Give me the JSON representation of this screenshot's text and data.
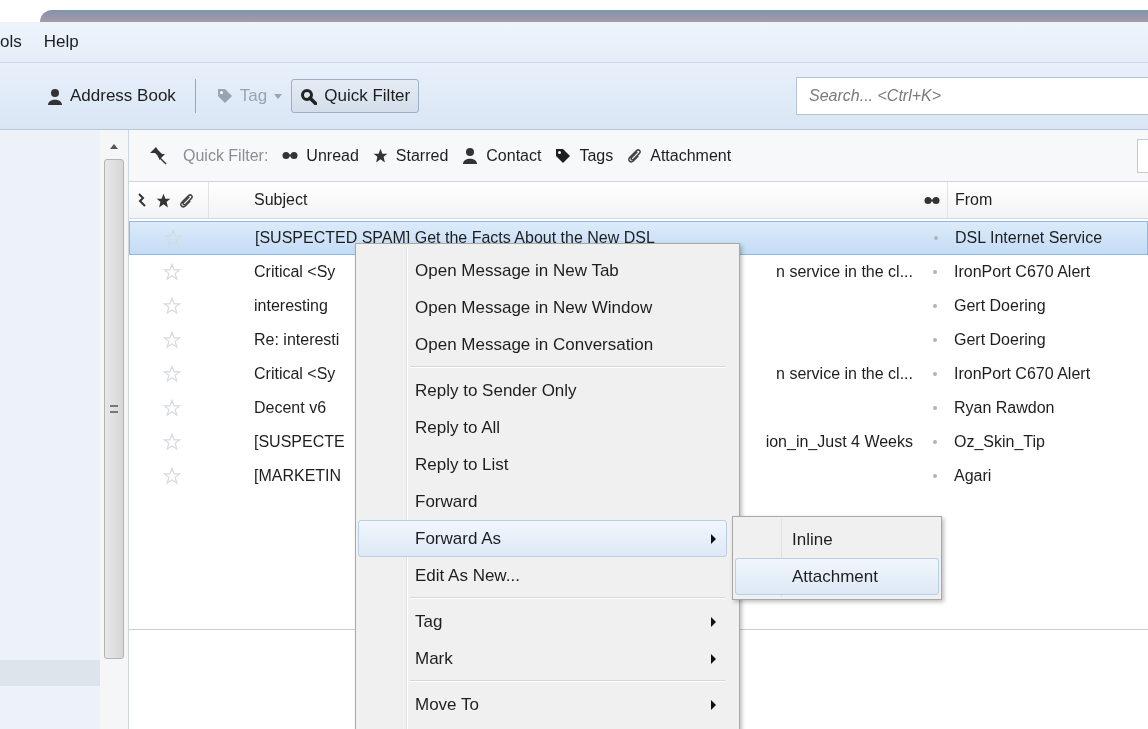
{
  "menubar": [
    {
      "label": "ols"
    },
    {
      "label": "Help"
    }
  ],
  "toolbar": {
    "buttons": [
      {
        "label": "Address Book",
        "kind": "contact",
        "disabled": false,
        "pressed": false,
        "dropdown": false
      },
      {
        "label": "Tag",
        "kind": "tag",
        "disabled": true,
        "pressed": false,
        "dropdown": true
      },
      {
        "label": "Quick Filter",
        "kind": "search",
        "disabled": false,
        "pressed": true,
        "dropdown": false
      }
    ],
    "search": {
      "placeholder": "Search... <Ctrl+K>"
    }
  },
  "quick_filter": {
    "label": "Quick Filter:",
    "filters": [
      {
        "label": "Unread",
        "kind": "unread"
      },
      {
        "label": "Starred",
        "kind": "starred"
      },
      {
        "label": "Contact",
        "kind": "contact"
      },
      {
        "label": "Tags",
        "kind": "tag"
      },
      {
        "label": "Attachment",
        "kind": "attachment"
      }
    ]
  },
  "columns": {
    "subject": "Subject",
    "from": "From"
  },
  "messages": [
    {
      "subject_start": "[SUSPECTED SPAM] Get the Facts About the New DSL",
      "from": "DSL Internet Service",
      "selected": true,
      "starred": false
    },
    {
      "subject_start": "Critical <Sy",
      "subject_end": "n service in the cl...",
      "from": "IronPort C670 Alert",
      "selected": false,
      "starred": false
    },
    {
      "subject_start": "interesting",
      "from": "Gert Doering",
      "selected": false,
      "starred": false
    },
    {
      "subject_start": "Re: interesti",
      "from": "Gert Doering",
      "selected": false,
      "starred": false
    },
    {
      "subject_start": "Critical <Sy",
      "subject_end": "n service in the cl...",
      "from": "IronPort C670 Alert",
      "selected": false,
      "starred": false
    },
    {
      "subject_start": "Decent v6",
      "from": "Ryan Rawdon",
      "selected": false,
      "starred": false
    },
    {
      "subject_start": "[SUSPECTE",
      "subject_end": "ion_in_Just 4 Weeks",
      "from": "Oz_Skin_Tip",
      "selected": false,
      "starred": false
    },
    {
      "subject_start": "[MARKETIN",
      "from": "Agari",
      "selected": false,
      "starred": false
    }
  ],
  "context_menu": {
    "items": [
      {
        "kind": "item",
        "label": "Open Message in New Tab",
        "submenu": false,
        "selected": false
      },
      {
        "kind": "item",
        "label": "Open Message in New Window",
        "submenu": false,
        "selected": false
      },
      {
        "kind": "item",
        "label": "Open Message in Conversation",
        "submenu": false,
        "selected": false
      },
      {
        "kind": "separator"
      },
      {
        "kind": "item",
        "label": "Reply to Sender Only",
        "submenu": false,
        "selected": false
      },
      {
        "kind": "item",
        "label": "Reply to All",
        "submenu": false,
        "selected": false
      },
      {
        "kind": "item",
        "label": "Reply to List",
        "submenu": false,
        "selected": false
      },
      {
        "kind": "item",
        "label": "Forward",
        "submenu": false,
        "selected": false
      },
      {
        "kind": "item",
        "label": "Forward As",
        "submenu": true,
        "selected": true
      },
      {
        "kind": "item",
        "label": "Edit As New...",
        "submenu": false,
        "selected": false
      },
      {
        "kind": "separator"
      },
      {
        "kind": "item",
        "label": "Tag",
        "submenu": true,
        "selected": false
      },
      {
        "kind": "item",
        "label": "Mark",
        "submenu": true,
        "selected": false
      },
      {
        "kind": "separator"
      },
      {
        "kind": "item",
        "label": "Move To",
        "submenu": true,
        "selected": false
      }
    ]
  },
  "submenu": {
    "items": [
      {
        "kind": "item",
        "label": "Inline",
        "submenu": false,
        "selected": false
      },
      {
        "kind": "item",
        "label": "Attachment",
        "submenu": false,
        "selected": true
      }
    ]
  }
}
